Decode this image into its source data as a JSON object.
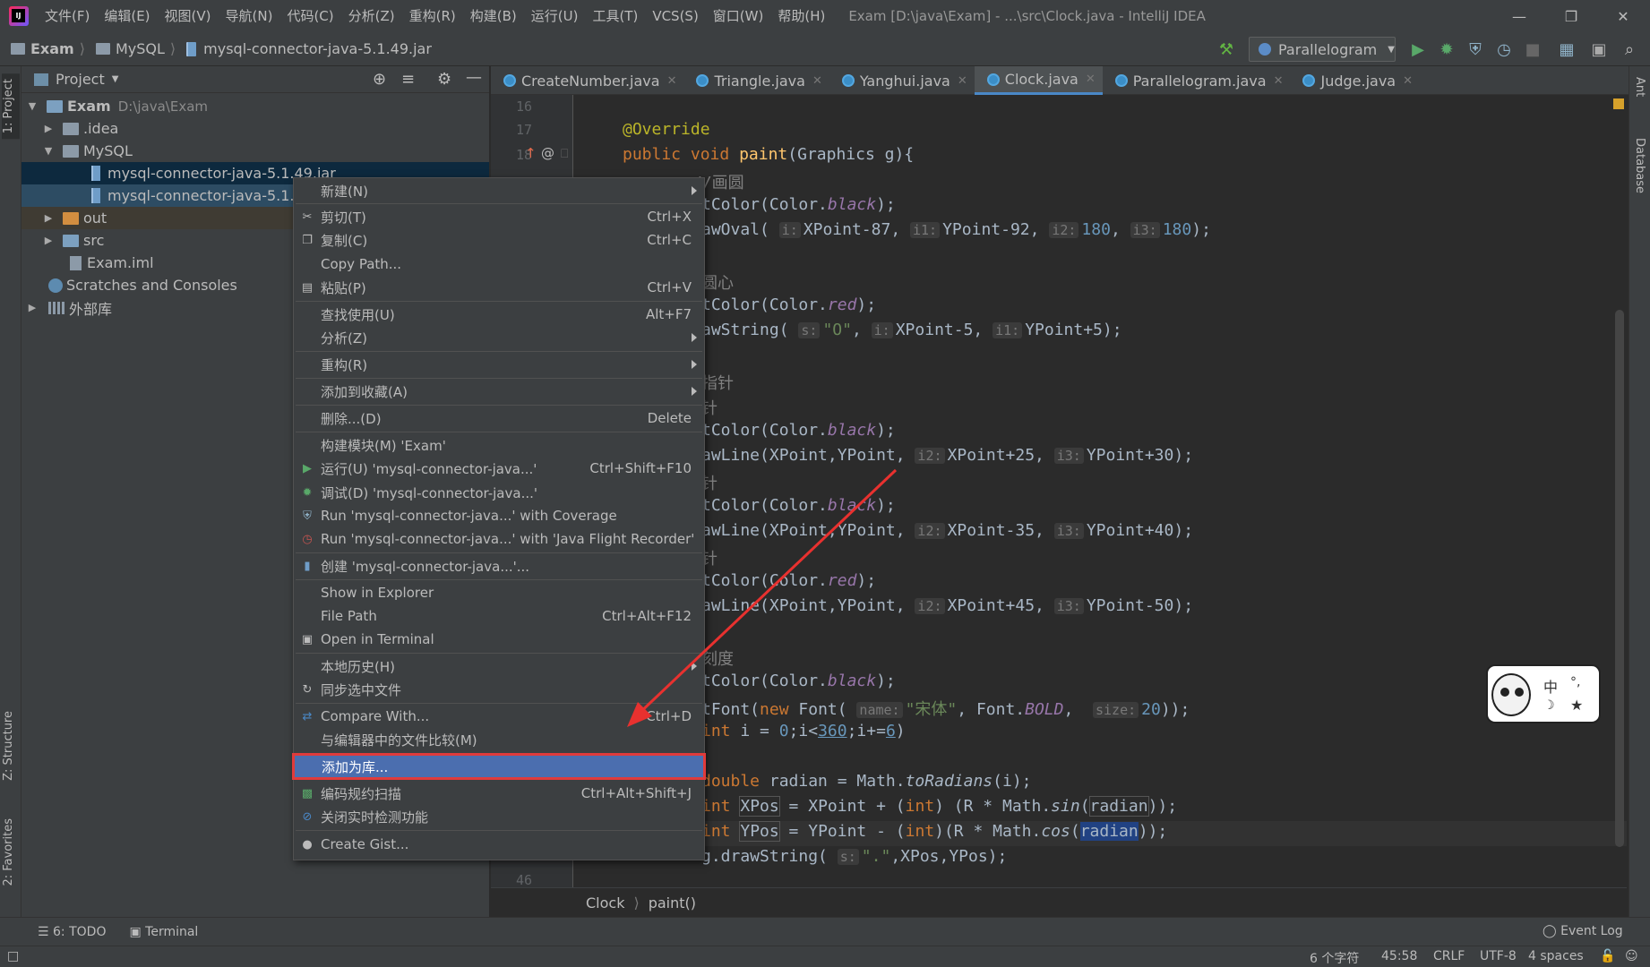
{
  "titlebar": {
    "menus": [
      "文件(F)",
      "编辑(E)",
      "视图(V)",
      "导航(N)",
      "代码(C)",
      "分析(Z)",
      "重构(R)",
      "构建(B)",
      "运行(U)",
      "工具(T)",
      "VCS(S)",
      "窗口(W)",
      "帮助(H)"
    ],
    "window_title": "Exam [D:\\java\\Exam] - ...\\src\\Clock.java - IntelliJ IDEA"
  },
  "navbar": {
    "crumbs": [
      "Exam",
      "MySQL",
      "mysql-connector-java-5.1.49.jar"
    ],
    "run_config": "Parallelogram"
  },
  "left_tabs": {
    "project": "1: Project",
    "structure": "Z: Structure",
    "favorites": "2: Favorites"
  },
  "right_tabs": {
    "ant": "Ant",
    "database": "Database"
  },
  "project_panel": {
    "title": "Project",
    "tree": [
      {
        "label": "Exam",
        "hint": "D:\\java\\Exam"
      },
      {
        "label": ".idea"
      },
      {
        "label": "MySQL"
      },
      {
        "label": "mysql-connector-java-5.1.49.jar"
      },
      {
        "label": "mysql-connector-java-5.1.49"
      },
      {
        "label": "out"
      },
      {
        "label": "src"
      },
      {
        "label": "Exam.iml"
      },
      {
        "label": "Scratches and Consoles"
      },
      {
        "label": "外部库"
      }
    ]
  },
  "tabs": [
    "CreateNumber.java",
    "Triangle.java",
    "Yanghui.java",
    "Clock.java",
    "Parallelogram.java",
    "Judge.java"
  ],
  "active_tab": "Clock.java",
  "gutter": {
    "line16": "16",
    "line17": "17",
    "line18": "18",
    "line46": "46"
  },
  "code": {
    "l_override": "@Override",
    "l_public": "public",
    "l_void": "void",
    "l_paint": "paint",
    "l_sig": "(Graphics g){",
    "l_comment1": "//画圆",
    "l_c_setcolor": "tColor(Color.",
    "l_black": "black",
    "l_close": ");",
    "l_drawoval": "awOval(",
    "l_drawoval_args": [
      "XPoint-87",
      "YPoint-92",
      "180",
      "180"
    ],
    "hints": {
      "i": "i:",
      "i1": "i1:",
      "i2": "i2:",
      "i3": "i3:",
      "s": "s:",
      "name": "name:",
      "size": "size:"
    },
    "l_comment2": "圆心",
    "l_red": "red",
    "l_drawstring": "awString(",
    "l_str_o": "\"O\"",
    "l_ds_args": [
      "XPoint-5",
      "YPoint+5"
    ],
    "l_comment3": "指针",
    "l_comment4": "针",
    "l_drawline": "awLine(",
    "l_line1": [
      "XPoint,YPoint,",
      "XPoint+25,",
      "YPoint+30"
    ],
    "l_line2": [
      "XPoint,YPoint,",
      "XPoint-35,",
      "YPoint+40"
    ],
    "l_line3": [
      "XPoint,YPoint,",
      "XPoint+45,",
      "YPoint-50"
    ],
    "l_comment5": "刻度",
    "l_setfont": "tFont(",
    "l_new": "new",
    "l_font": "Font(",
    "l_songti": "\"宋体\"",
    "l_fontbold": ", Font.",
    "l_bold": "BOLD",
    "l_20": "20",
    "l_for": "int",
    "l_for_rest": [
      " i = ",
      "0",
      ";i<",
      "360",
      ";i+=",
      "6",
      ")"
    ],
    "l_double": "double",
    "l_radian_decl": " radian = Math.",
    "l_toradians": "toRadians",
    "l_i_arg": "(i);",
    "l_int": "int",
    "l_xpos": "XPos",
    "l_ypos": "YPos",
    "l_xpos_rest": " = XPoint + (",
    "l_ypos_rest": " = YPoint - (",
    "l_int2": "int",
    "l_r_math": ") (R * Math.",
    "l_r_math2": ")(R * Math.",
    "l_sin": "sin",
    "l_cos": "cos",
    "l_radian": "radian",
    "l_end": "));",
    "l_drawstring2": "g.drawString(",
    "l_dot": "\".\"",
    "l_ds2_rest": ",XPos,YPos);"
  },
  "breadcrumb": {
    "class": "Clock",
    "method": "paint()"
  },
  "context_menu": [
    {
      "label": "新建(N)",
      "sub": true
    },
    {
      "label": "剪切(T)",
      "shortcut": "Ctrl+X",
      "icon": "scissors-icon"
    },
    {
      "label": "复制(C)",
      "shortcut": "Ctrl+C",
      "icon": "copy-icon"
    },
    {
      "label": "Copy Path..."
    },
    {
      "label": "粘贴(P)",
      "shortcut": "Ctrl+V",
      "icon": "paste-icon"
    },
    {
      "label": "查找使用(U)",
      "shortcut": "Alt+F7"
    },
    {
      "label": "分析(Z)",
      "sub": true
    },
    {
      "label": "重构(R)",
      "sub": true
    },
    {
      "label": "添加到收藏(A)",
      "sub": true
    },
    {
      "label": "删除...(D)",
      "shortcut": "Delete"
    },
    {
      "label": "构建模块(M) 'Exam'"
    },
    {
      "label": "运行(U) 'mysql-connector-java...'",
      "shortcut": "Ctrl+Shift+F10",
      "icon": "run-icon"
    },
    {
      "label": "调试(D) 'mysql-connector-java...'",
      "icon": "debug-icon"
    },
    {
      "label": "Run 'mysql-connector-java...' with Coverage",
      "icon": "coverage-icon"
    },
    {
      "label": "Run 'mysql-connector-java...' with 'Java Flight Recorder'",
      "icon": "profiler-icon"
    },
    {
      "label": "创建 'mysql-connector-java...'...",
      "icon": "jar-icon"
    },
    {
      "label": "Show in Explorer"
    },
    {
      "label": "File Path",
      "shortcut": "Ctrl+Alt+F12"
    },
    {
      "label": "Open in Terminal",
      "icon": "terminal-icon"
    },
    {
      "label": "本地历史(H)",
      "sub": true
    },
    {
      "label": "同步选中文件",
      "icon": "sync-icon"
    },
    {
      "label": "Compare With...",
      "shortcut": "Ctrl+D",
      "icon": "compare-icon"
    },
    {
      "label": "与编辑器中的文件比较(M)"
    },
    {
      "label": "添加为库..."
    },
    {
      "label": "编码规约扫描",
      "shortcut": "Ctrl+Alt+Shift+J",
      "icon": "scan-icon"
    },
    {
      "label": "关闭实时检测功能",
      "icon": "disable-icon"
    },
    {
      "label": "Create Gist...",
      "icon": "github-icon"
    }
  ],
  "bottom_tabs": {
    "todo": "6: TODO",
    "terminal": "Terminal",
    "event_log": "Event Log"
  },
  "status": {
    "chars": "6 个字符",
    "position": "45:58",
    "line_sep": "CRLF",
    "encoding": "UTF-8",
    "indent": "4 spaces"
  },
  "colors": {
    "selection": "#4b6eaf",
    "highlight_box": "#e03b3b",
    "arrow": "#e8312f"
  }
}
